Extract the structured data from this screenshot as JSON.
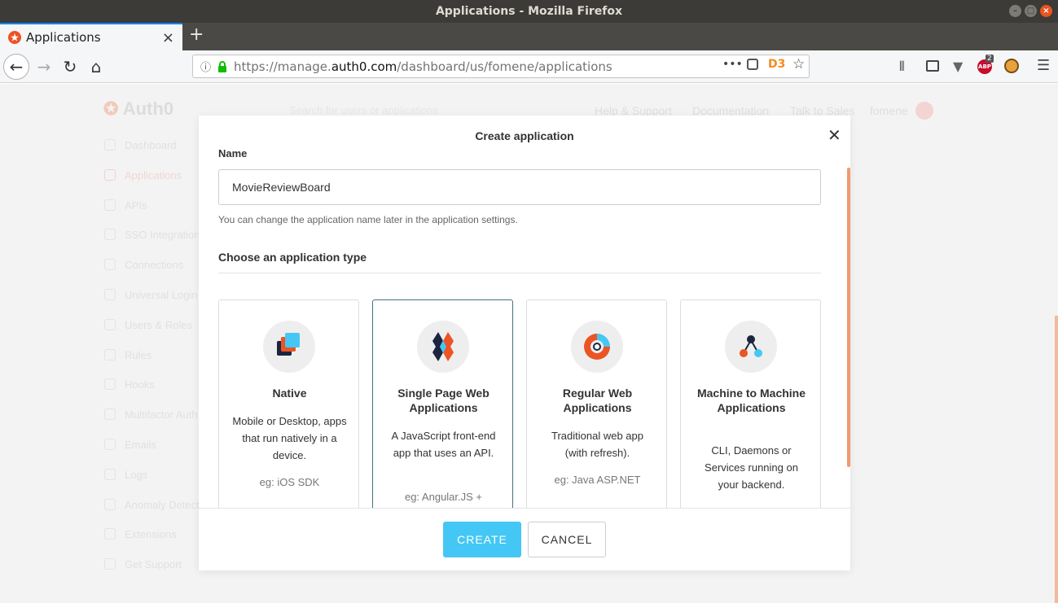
{
  "window": {
    "title": "Applications - Mozilla Firefox"
  },
  "tab": {
    "title": "Applications"
  },
  "navbar": {
    "url_prefix": "https://manage.",
    "url_domain": "auth0.com",
    "url_path": "/dashboard/us/fomene/applications",
    "abp_badge": "2"
  },
  "background": {
    "logo": "Auth0",
    "search_placeholder": "Search for users or applications",
    "top_links": [
      "Help & Support",
      "Documentation",
      "Talk to Sales",
      "fomene"
    ],
    "sidebar": [
      "Dashboard",
      "Applications",
      "APIs",
      "SSO Integrations",
      "Connections",
      "Universal Login",
      "Users & Roles",
      "Rules",
      "Hooks",
      "Multifactor Auth",
      "Emails",
      "Logs",
      "Anomaly Detection",
      "Extensions",
      "Get Support"
    ]
  },
  "modal": {
    "title": "Create application",
    "name_label": "Name",
    "name_value": "MovieReviewBoard",
    "name_help": "You can change the application name later in the application settings.",
    "type_section_title": "Choose an application type",
    "cards": [
      {
        "name": "Native",
        "desc": "Mobile or Desktop, apps that run natively in a device.",
        "example": "eg: iOS SDK",
        "selected": false
      },
      {
        "name": "Single Page Web Applications",
        "desc": "A JavaScript front-end app that uses an API.",
        "example": "eg: Angular.JS +",
        "selected": true
      },
      {
        "name": "Regular Web Applications",
        "desc": "Traditional web app (with refresh).",
        "example": "eg: Java ASP.NET",
        "selected": false
      },
      {
        "name": "Machine to Machine Applications",
        "desc": "CLI, Daemons or Services running on your backend.",
        "example": "",
        "selected": false
      }
    ],
    "create_label": "CREATE",
    "cancel_label": "CANCEL"
  },
  "colors": {
    "primary": "#44c7f4",
    "accent": "#eb5424",
    "selected_border": "#44747a"
  }
}
